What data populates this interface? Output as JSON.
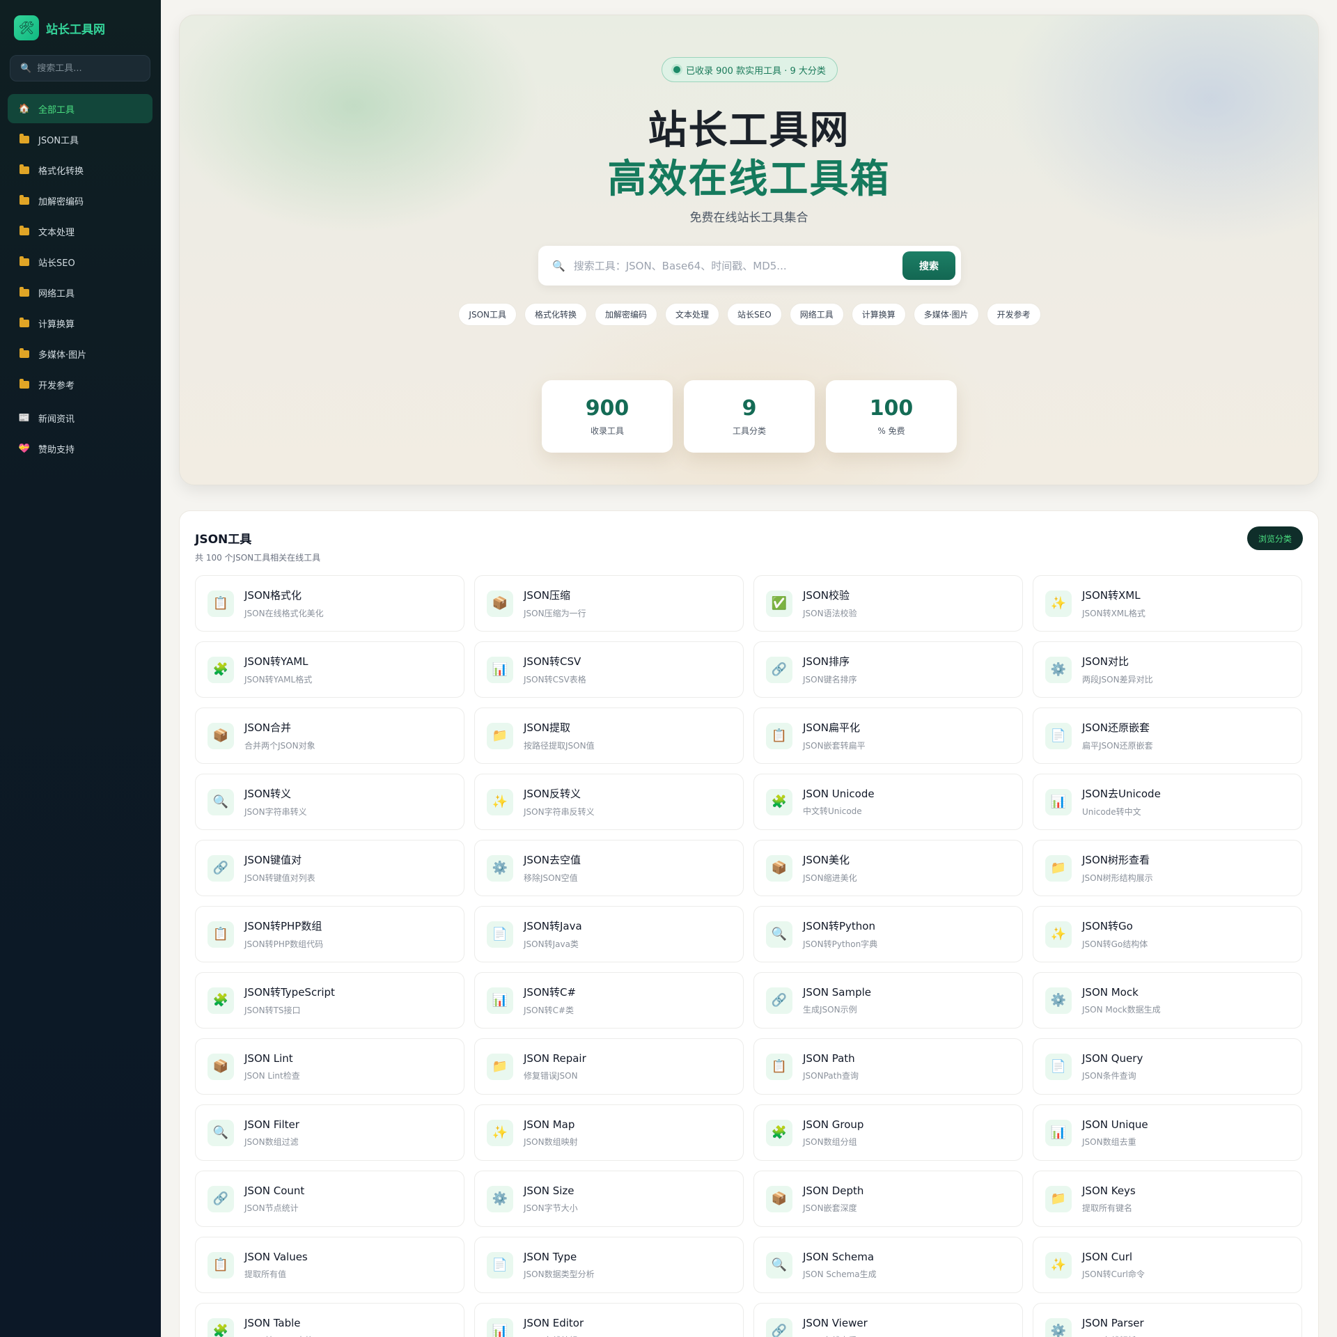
{
  "sidebar": {
    "brand": "站长工具网",
    "brand_icon": "🛠",
    "search_placeholder": "搜索工具...",
    "items": [
      {
        "label": "全部工具",
        "icon": "🏠",
        "active": true
      },
      {
        "label": "JSON工具",
        "icon": "folder"
      },
      {
        "label": "格式化转换",
        "icon": "folder"
      },
      {
        "label": "加解密编码",
        "icon": "folder"
      },
      {
        "label": "文本处理",
        "icon": "folder"
      },
      {
        "label": "站长SEO",
        "icon": "folder"
      },
      {
        "label": "网络工具",
        "icon": "folder"
      },
      {
        "label": "计算换算",
        "icon": "folder"
      },
      {
        "label": "多媒体·图片",
        "icon": "folder"
      },
      {
        "label": "开发参考",
        "icon": "folder"
      },
      {
        "label": "新闻资讯",
        "icon": "📰"
      },
      {
        "label": "赞助支持",
        "icon": "💝"
      }
    ]
  },
  "hero": {
    "badge": "已收录 900 款实用工具 · 9 大分类",
    "title_line1": "站长工具网",
    "title_line2": "高效在线工具箱",
    "subtitle": "免费在线站长工具集合",
    "search_placeholder": "搜索工具：JSON、Base64、时间戳、MD5...",
    "search_button": "搜索",
    "chips": [
      "JSON工具",
      "格式化转换",
      "加解密编码",
      "文本处理",
      "站长SEO",
      "网络工具",
      "计算换算",
      "多媒体·图片",
      "开发参考"
    ],
    "stats": [
      {
        "value": "900",
        "label": "收录工具"
      },
      {
        "value": "9",
        "label": "工具分类"
      },
      {
        "value": "100",
        "label": "% 免费"
      }
    ]
  },
  "section": {
    "title": "JSON工具",
    "subtitle": "共 100 个JSON工具相关在线工具",
    "button": "浏览分类",
    "cards": [
      {
        "icon": "📋",
        "title": "JSON格式化",
        "desc": "JSON在线格式化美化"
      },
      {
        "icon": "📦",
        "title": "JSON压缩",
        "desc": "JSON压缩为一行"
      },
      {
        "icon": "✅",
        "title": "JSON校验",
        "desc": "JSON语法校验"
      },
      {
        "icon": "✨",
        "title": "JSON转XML",
        "desc": "JSON转XML格式"
      },
      {
        "icon": "🧩",
        "title": "JSON转YAML",
        "desc": "JSON转YAML格式"
      },
      {
        "icon": "📊",
        "title": "JSON转CSV",
        "desc": "JSON转CSV表格"
      },
      {
        "icon": "🔗",
        "title": "JSON排序",
        "desc": "JSON键名排序"
      },
      {
        "icon": "⚙️",
        "title": "JSON对比",
        "desc": "两段JSON差异对比"
      },
      {
        "icon": "📦",
        "title": "JSON合并",
        "desc": "合并两个JSON对象"
      },
      {
        "icon": "📁",
        "title": "JSON提取",
        "desc": "按路径提取JSON值"
      },
      {
        "icon": "📋",
        "title": "JSON扁平化",
        "desc": "JSON嵌套转扁平"
      },
      {
        "icon": "📄",
        "title": "JSON还原嵌套",
        "desc": "扁平JSON还原嵌套"
      },
      {
        "icon": "🔍",
        "title": "JSON转义",
        "desc": "JSON字符串转义"
      },
      {
        "icon": "✨",
        "title": "JSON反转义",
        "desc": "JSON字符串反转义"
      },
      {
        "icon": "🧩",
        "title": "JSON Unicode",
        "desc": "中文转Unicode"
      },
      {
        "icon": "📊",
        "title": "JSON去Unicode",
        "desc": "Unicode转中文"
      },
      {
        "icon": "🔗",
        "title": "JSON键值对",
        "desc": "JSON转键值对列表"
      },
      {
        "icon": "⚙️",
        "title": "JSON去空值",
        "desc": "移除JSON空值"
      },
      {
        "icon": "📦",
        "title": "JSON美化",
        "desc": "JSON缩进美化"
      },
      {
        "icon": "📁",
        "title": "JSON树形查看",
        "desc": "JSON树形结构展示"
      },
      {
        "icon": "📋",
        "title": "JSON转PHP数组",
        "desc": "JSON转PHP数组代码"
      },
      {
        "icon": "📄",
        "title": "JSON转Java",
        "desc": "JSON转Java类"
      },
      {
        "icon": "🔍",
        "title": "JSON转Python",
        "desc": "JSON转Python字典"
      },
      {
        "icon": "✨",
        "title": "JSON转Go",
        "desc": "JSON转Go结构体"
      },
      {
        "icon": "🧩",
        "title": "JSON转TypeScript",
        "desc": "JSON转TS接口"
      },
      {
        "icon": "📊",
        "title": "JSON转C#",
        "desc": "JSON转C#类"
      },
      {
        "icon": "🔗",
        "title": "JSON Sample",
        "desc": "生成JSON示例"
      },
      {
        "icon": "⚙️",
        "title": "JSON Mock",
        "desc": "JSON Mock数据生成"
      },
      {
        "icon": "📦",
        "title": "JSON Lint",
        "desc": "JSON Lint检查"
      },
      {
        "icon": "📁",
        "title": "JSON Repair",
        "desc": "修复错误JSON"
      },
      {
        "icon": "📋",
        "title": "JSON Path",
        "desc": "JSONPath查询"
      },
      {
        "icon": "📄",
        "title": "JSON Query",
        "desc": "JSON条件查询"
      },
      {
        "icon": "🔍",
        "title": "JSON Filter",
        "desc": "JSON数组过滤"
      },
      {
        "icon": "✨",
        "title": "JSON Map",
        "desc": "JSON数组映射"
      },
      {
        "icon": "🧩",
        "title": "JSON Group",
        "desc": "JSON数组分组"
      },
      {
        "icon": "📊",
        "title": "JSON Unique",
        "desc": "JSON数组去重"
      },
      {
        "icon": "🔗",
        "title": "JSON Count",
        "desc": "JSON节点统计"
      },
      {
        "icon": "⚙️",
        "title": "JSON Size",
        "desc": "JSON字节大小"
      },
      {
        "icon": "📦",
        "title": "JSON Depth",
        "desc": "JSON嵌套深度"
      },
      {
        "icon": "📁",
        "title": "JSON Keys",
        "desc": "提取所有键名"
      },
      {
        "icon": "📋",
        "title": "JSON Values",
        "desc": "提取所有值"
      },
      {
        "icon": "📄",
        "title": "JSON Type",
        "desc": "JSON数据类型分析"
      },
      {
        "icon": "🔍",
        "title": "JSON Schema",
        "desc": "JSON Schema生成"
      },
      {
        "icon": "✨",
        "title": "JSON Curl",
        "desc": "JSON转Curl命令"
      },
      {
        "icon": "🧩",
        "title": "JSON Table",
        "desc": "JSON转HTML表格"
      },
      {
        "icon": "📊",
        "title": "JSON Editor",
        "desc": "JSON在线编辑"
      },
      {
        "icon": "🔗",
        "title": "JSON Viewer",
        "desc": "JSON在线查看"
      },
      {
        "icon": "⚙️",
        "title": "JSON Parser",
        "desc": "JSON在线解析"
      }
    ]
  }
}
